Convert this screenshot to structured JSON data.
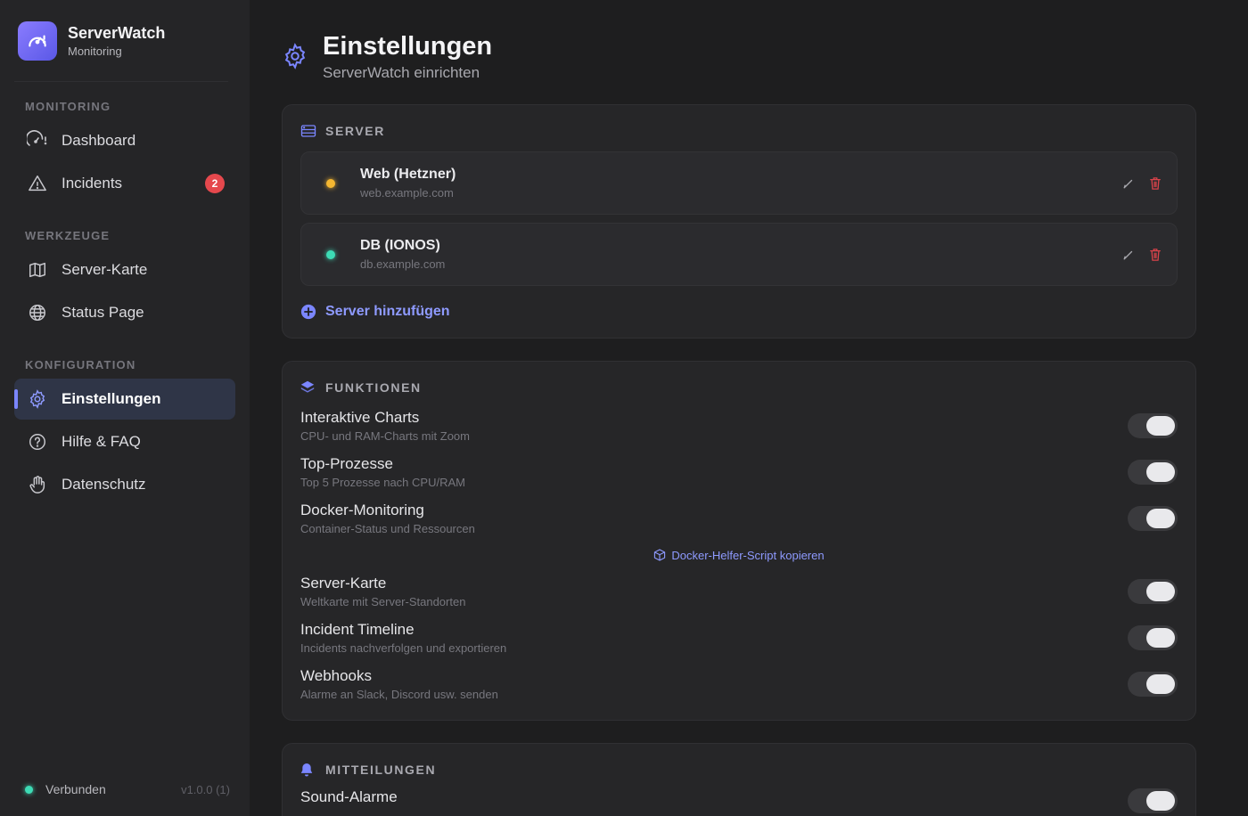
{
  "app": {
    "name": "ServerWatch",
    "subtitle": "Monitoring"
  },
  "sidebar": {
    "sections": [
      {
        "title": "MONITORING",
        "items": [
          {
            "label": "Dashboard",
            "icon": "gauge-icon"
          },
          {
            "label": "Incidents",
            "icon": "warning-icon",
            "badge": "2"
          }
        ]
      },
      {
        "title": "WERKZEUGE",
        "items": [
          {
            "label": "Server-Karte",
            "icon": "map-icon"
          },
          {
            "label": "Status Page",
            "icon": "globe-icon"
          }
        ]
      },
      {
        "title": "KONFIGURATION",
        "items": [
          {
            "label": "Einstellungen",
            "icon": "gear-icon",
            "active": true
          },
          {
            "label": "Hilfe & FAQ",
            "icon": "help-icon"
          },
          {
            "label": "Datenschutz",
            "icon": "hand-icon"
          }
        ]
      }
    ],
    "footer": {
      "status": "Verbunden",
      "version": "v1.0.0 (1)"
    }
  },
  "header": {
    "title": "Einstellungen",
    "subtitle": "ServerWatch einrichten"
  },
  "server_card": {
    "title": "SERVER",
    "servers": [
      {
        "name": "Web (Hetzner)",
        "host": "web.example.com",
        "status_color": "#f5b731"
      },
      {
        "name": "DB (IONOS)",
        "host": "db.example.com",
        "status_color": "#3ddbb5"
      }
    ],
    "add_label": "Server hinzufügen"
  },
  "features_card": {
    "title": "FUNKTIONEN",
    "features": [
      {
        "name": "Interaktive Charts",
        "desc": "CPU- und RAM-Charts mit Zoom",
        "enabled": true
      },
      {
        "name": "Top-Prozesse",
        "desc": "Top 5 Prozesse nach CPU/RAM",
        "enabled": true
      },
      {
        "name": "Docker-Monitoring",
        "desc": "Container-Status und Ressourcen",
        "enabled": true
      },
      {
        "name": "Server-Karte",
        "desc": "Weltkarte mit Server-Standorten",
        "enabled": true
      },
      {
        "name": "Incident Timeline",
        "desc": "Incidents nachverfolgen und exportieren",
        "enabled": true
      },
      {
        "name": "Webhooks",
        "desc": "Alarme an Slack, Discord usw. senden",
        "enabled": true
      }
    ],
    "docker_helper_label": "Docker-Helfer-Script kopieren"
  },
  "notifications_card": {
    "title": "MITTEILUNGEN",
    "features": [
      {
        "name": "Sound-Alarme",
        "enabled": true
      }
    ]
  },
  "colors": {
    "accent": "#7b86ff",
    "connected": "#3ddbb5",
    "danger": "#e5484d"
  }
}
